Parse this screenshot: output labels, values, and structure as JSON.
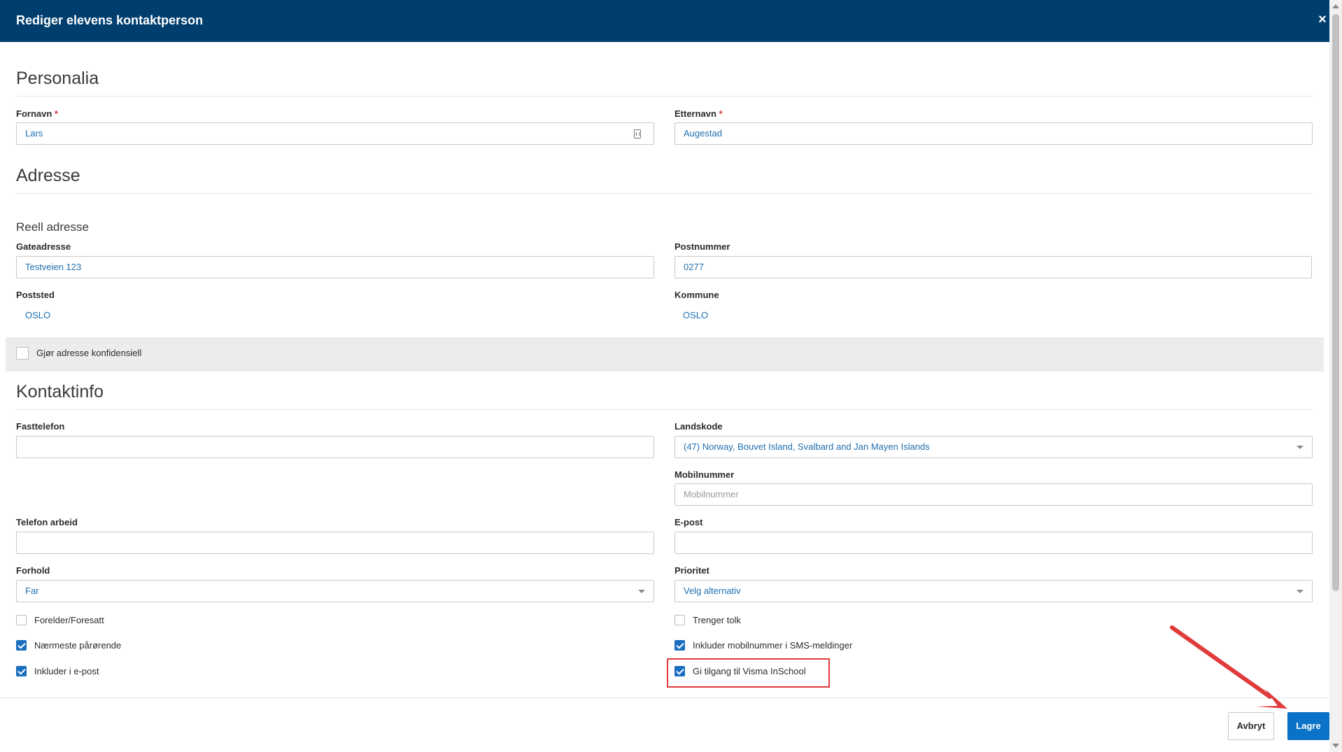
{
  "dialog": {
    "title": "Rediger elevens kontaktperson"
  },
  "sections": {
    "personalia": "Personalia",
    "adresse": "Adresse",
    "reell_adresse": "Reell adresse",
    "kontaktinfo": "Kontaktinfo"
  },
  "fields": {
    "fornavn": {
      "label": "Fornavn",
      "required": "*",
      "value": "Lars"
    },
    "etternavn": {
      "label": "Etternavn",
      "required": "*",
      "value": "Augestad"
    },
    "gateadresse": {
      "label": "Gateadresse",
      "value": "Testveien 123"
    },
    "postnummer": {
      "label": "Postnummer",
      "value": "0277"
    },
    "poststed": {
      "label": "Poststed",
      "value": "OSLO"
    },
    "kommune": {
      "label": "Kommune",
      "value": "OSLO"
    },
    "fasttelefon": {
      "label": "Fasttelefon",
      "value": ""
    },
    "landskode": {
      "label": "Landskode",
      "value": "(47) Norway, Bouvet Island, Svalbard and Jan Mayen Islands"
    },
    "mobilnummer": {
      "label": "Mobilnummer",
      "placeholder": "Mobilnummer"
    },
    "telefon_arbeid": {
      "label": "Telefon arbeid",
      "value": ""
    },
    "epost": {
      "label": "E-post",
      "value": ""
    },
    "forhold": {
      "label": "Forhold",
      "value": "Far"
    },
    "prioritet": {
      "label": "Prioritet",
      "value": "Velg alternativ"
    }
  },
  "checkboxes": {
    "konfidensiell": {
      "label": "Gjør adresse konfidensiell",
      "checked": false
    },
    "forelder": {
      "label": "Forelder/Foresatt",
      "checked": false
    },
    "naermeste": {
      "label": "Nærmeste pårørende",
      "checked": true
    },
    "inkluder_epost": {
      "label": "Inkluder i e-post",
      "checked": true
    },
    "tolk": {
      "label": "Trenger tolk",
      "checked": false
    },
    "sms": {
      "label": "Inkluder mobilnummer i SMS-meldinger",
      "checked": true
    },
    "visma": {
      "label": "Gi tilgang til Visma InSchool",
      "checked": true
    }
  },
  "buttons": {
    "cancel": "Avbryt",
    "save": "Lagre",
    "close": "×"
  },
  "colors": {
    "header": "#003e6e",
    "primary": "#0a73c7",
    "link_value": "#1f6fb0",
    "annotation": "#e03a3a"
  }
}
